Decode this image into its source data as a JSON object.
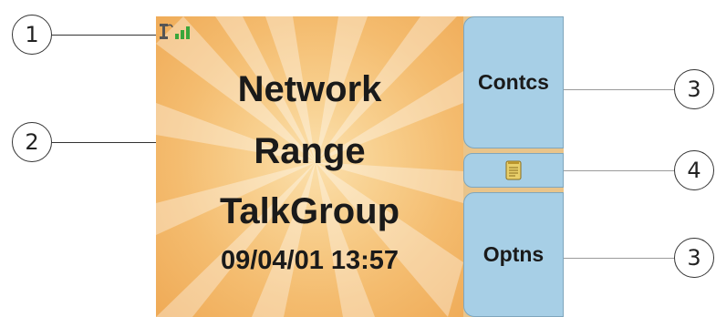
{
  "screen": {
    "home": {
      "line1": "Network",
      "line2": "Range",
      "line3": "TalkGroup",
      "datetime": "09/04/01 13:57"
    },
    "softkeys": {
      "top_label": "Contcs",
      "bottom_label": "Optns",
      "middle_icon": "notepad-icon"
    },
    "status_icon": "antenna-signal-icon"
  },
  "callouts": {
    "c1": "1",
    "c2": "2",
    "c3a": "3",
    "c4": "4",
    "c3b": "3"
  },
  "colors": {
    "background_center": "#fbe0ad",
    "background_edge": "#efaa56",
    "softkey": "#a7cfe6",
    "signal_bars": "#3aa63a"
  }
}
